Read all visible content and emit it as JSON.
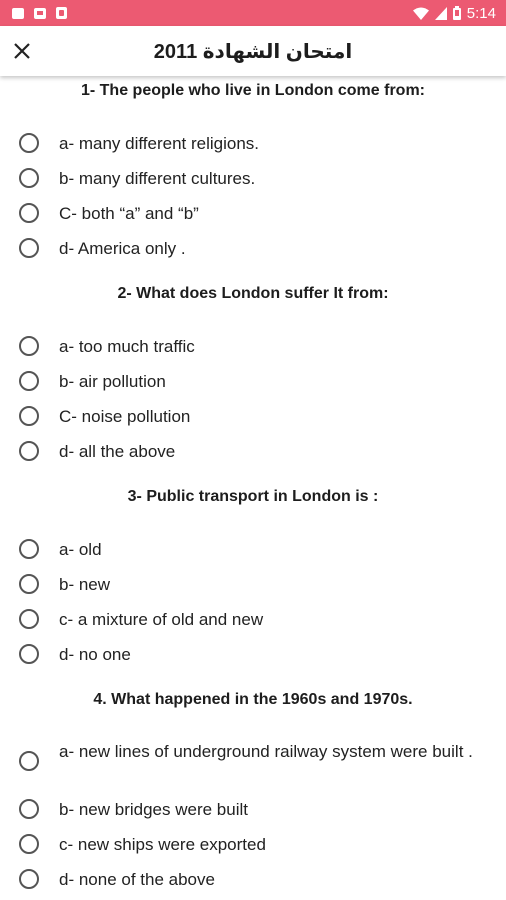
{
  "status_bar": {
    "time": "5:14",
    "left_icons": [
      "notification-icon",
      "message-icon",
      "app-icon"
    ],
    "right_icons": [
      "wifi-icon",
      "signal-icon",
      "battery-icon"
    ],
    "color": "#ec5a72"
  },
  "app_bar": {
    "title": "امتحان الشهادة 2011",
    "close_icon": "close-icon"
  },
  "questions": [
    {
      "text": "1- The people who live in London come from:",
      "options": [
        "a- many different religions.",
        "b- many different cultures.",
        "C- both “a” and “b”",
        "d- America only ."
      ]
    },
    {
      "text": "2- What does London suffer It from:",
      "options": [
        "a- too much traffic",
        "b- air pollution",
        "C- noise pollution",
        "d- all the above"
      ]
    },
    {
      "text": "3- Public transport in London is :",
      "options": [
        "a- old",
        "b- new",
        "c- a mixture of old and new",
        "d- no one"
      ]
    },
    {
      "text": "4. What happened in the 1960s and 1970s.",
      "options": [
        "a- new lines of underground railway system were built .",
        "b- new bridges were built",
        "c- new ships were exported",
        "d- none of the above"
      ]
    }
  ]
}
